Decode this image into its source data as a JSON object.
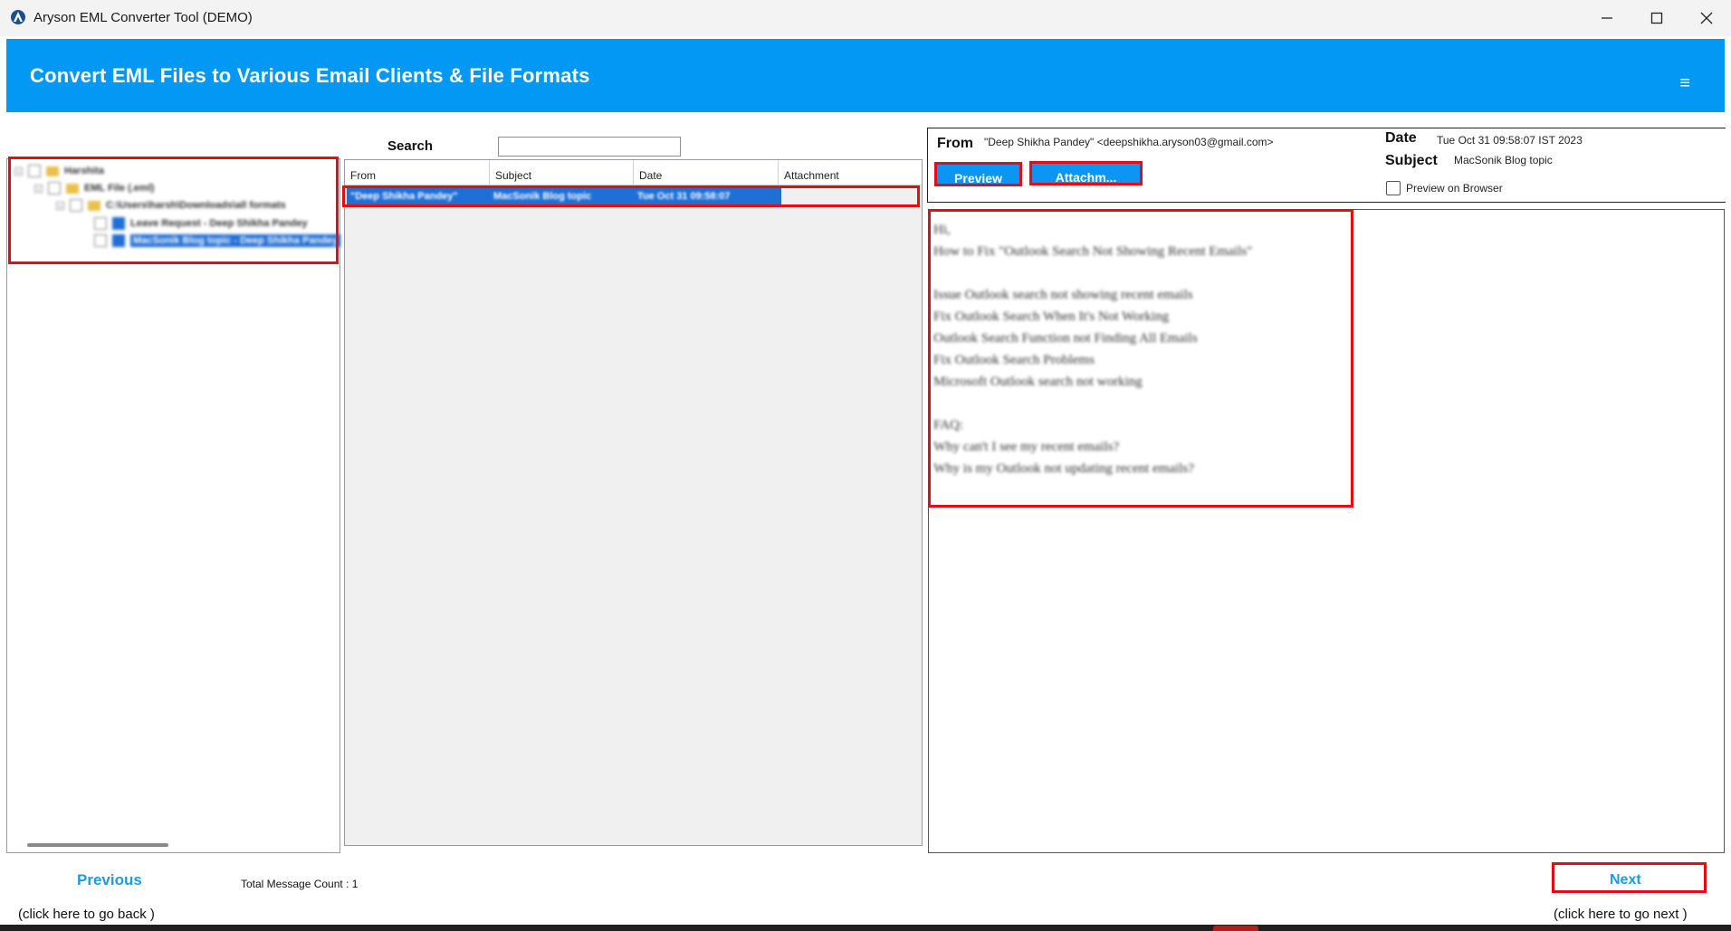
{
  "window": {
    "title": "Aryson EML Converter Tool (DEMO)",
    "controls": [
      "minimize",
      "maximize",
      "close"
    ]
  },
  "banner": {
    "title": "Convert EML Files to Various Email Clients & File Formats",
    "menu_icon": "hamburger-icon"
  },
  "tree": {
    "items": [
      {
        "label": "Harshita",
        "level": 0,
        "checked": false
      },
      {
        "label": "EML File (.eml)",
        "level": 1,
        "checked": false
      },
      {
        "label": "C:\\Users\\harsh\\Downloads\\all formats",
        "level": 2,
        "checked": false
      },
      {
        "label": "Leave Request - Deep Shikha Pandey",
        "level": 3,
        "checked": true
      },
      {
        "label": "MacSonik Blog topic - Deep Shikha Pandey",
        "level": 3,
        "checked": true,
        "selected": true
      }
    ]
  },
  "search": {
    "label": "Search",
    "value": ""
  },
  "message_list": {
    "columns": [
      "From",
      "Subject",
      "Date",
      "Attachment"
    ],
    "rows": [
      {
        "from": "\"Deep Shikha Pandey\"",
        "subject": "MacSonik Blog topic",
        "date": "Tue Oct 31 09:58:07",
        "attachment": ""
      }
    ]
  },
  "preview": {
    "from_label": "From",
    "from_value": "\"Deep Shikha Pandey\" <deepshikha.aryson03@gmail.com>",
    "date_label": "Date",
    "date_value": "Tue Oct 31 09:58:07 IST 2023",
    "subject_label": "Subject",
    "subject_value": "MacSonik Blog topic",
    "preview_button": "Preview",
    "attachment_button": "Attachm...",
    "browser_checkbox_label": "Preview on Browser",
    "browser_checkbox_checked": false,
    "body_lines": [
      "Hi,",
      "How to Fix \"Outlook Search Not Showing Recent Emails\"",
      "",
      "Issue Outlook search not showing recent emails",
      "Fix Outlook Search When It's Not Working",
      "Outlook Search Function not Finding All Emails",
      "Fix Outlook Search Problems",
      "Microsoft Outlook search not working",
      "",
      "FAQ:",
      "Why can't I see my recent emails?",
      "Why is my Outlook not updating recent emails?"
    ]
  },
  "footer": {
    "previous_label": "Previous",
    "previous_hint": "(click here to  go back )",
    "count_label": "Total Message Count : 1",
    "next_label": "Next",
    "next_hint": "(click here to  go next )"
  },
  "colors": {
    "accent": "#0398f4",
    "highlight": "#e10d17",
    "selection": "#1f6fd6",
    "link": "#1e9be0"
  }
}
